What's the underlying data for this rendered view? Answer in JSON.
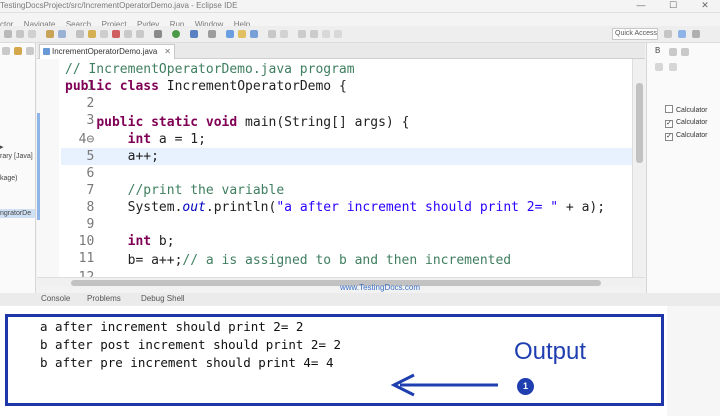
{
  "window": {
    "title": "TestingDocsProject/src/IncrementOperatorDemo.java - Eclipse IDE",
    "minimize": "—",
    "maximize": "☐",
    "close": "✕"
  },
  "menu": [
    "ctor",
    "Navigate",
    "Search",
    "Project",
    "Pydev",
    "Run",
    "Window",
    "Help"
  ],
  "toolbar": {
    "quick_access": "Quick Access"
  },
  "left_panel": {
    "items": [
      "rary [Java]",
      "kage)",
      "ngratorDe"
    ]
  },
  "editor": {
    "tab_label": "IncrementOperatorDemo.java",
    "tab_close": "✕",
    "lines": [
      {
        "num": "1",
        "text": "// IncrementOperatorDemo.java program"
      },
      {
        "num": "2",
        "text": "public class IncrementOperatorDemo {"
      },
      {
        "num": "3",
        "text": ""
      },
      {
        "num": "4⊖",
        "text": "    public static void main(String[] args) {"
      },
      {
        "num": "5",
        "text": "        int a = 1;"
      },
      {
        "num": "6",
        "text": "        a++;"
      },
      {
        "num": "7",
        "text": ""
      },
      {
        "num": "8",
        "text": "        //print the variable"
      },
      {
        "num": "9",
        "text": "        System.out.println(\"a after increment should print 2= \" + a);"
      },
      {
        "num": "10",
        "text": ""
      },
      {
        "num": "11",
        "text": "        int b;"
      },
      {
        "num": "12",
        "text": "        b= a++;// a is assigned to b and then incremented"
      }
    ]
  },
  "watermark": "www.TestingDocs.com",
  "right_panel": {
    "tab": "B",
    "items": [
      "Calculator",
      "Calculator",
      "Calculator"
    ]
  },
  "console": {
    "tabs": [
      "Console",
      "Problems",
      "Debug Shell"
    ],
    "output_lines": [
      "a after increment should print 2= 2",
      "b after post increment should print 2= 2",
      "b after pre increment should print 4= 4"
    ]
  },
  "annotation": {
    "label": "Output",
    "badge": "1",
    "color": "#1f3fb0"
  }
}
